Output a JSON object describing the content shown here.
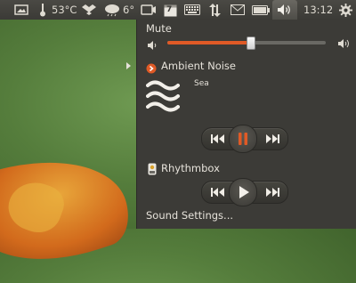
{
  "panel": {
    "temperature": "53°C",
    "weather_temp": "6°",
    "calendar_day": "7",
    "clock": "13:12"
  },
  "sound_menu": {
    "mute_label": "Mute",
    "volume_level": 0.52,
    "players": [
      {
        "name": "Ambient Noise",
        "track": "Sea",
        "state": "playing"
      },
      {
        "name": "Rhythmbox",
        "state": "paused"
      }
    ],
    "settings_label": "Sound Settings..."
  },
  "colors": {
    "panel_bg": "#3b3a36",
    "menu_bg": "#3c3b37",
    "accent": "#e05a26",
    "text": "#dfdbd2"
  }
}
